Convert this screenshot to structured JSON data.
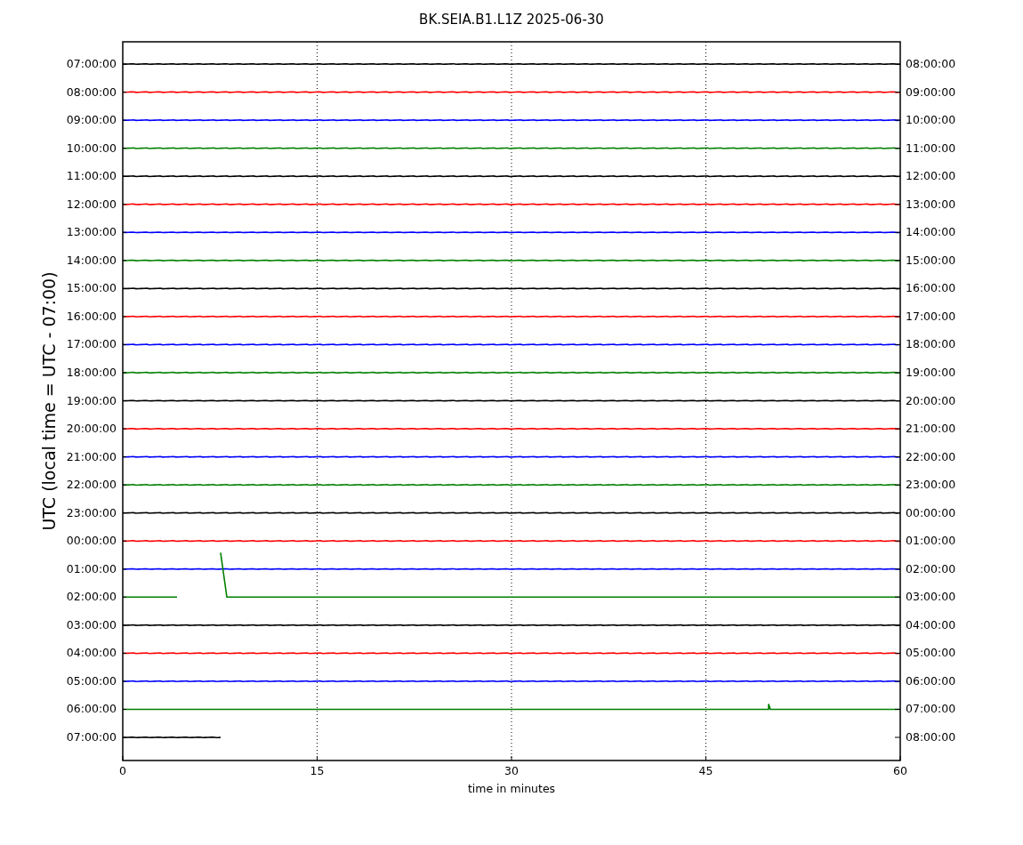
{
  "title": "BK.SEIA.B1.L1Z 2025-06-30",
  "ylabel": "UTC (local time = UTC - 07:00)",
  "xlabel": "time in minutes",
  "xticks": [
    "0",
    "15",
    "30",
    "45",
    "60"
  ],
  "rows": [
    {
      "left": "07:00:00",
      "right": "08:00:00",
      "color": "#000000"
    },
    {
      "left": "08:00:00",
      "right": "09:00:00",
      "color": "#ff0000"
    },
    {
      "left": "09:00:00",
      "right": "10:00:00",
      "color": "#0000ff"
    },
    {
      "left": "10:00:00",
      "right": "11:00:00",
      "color": "#008000"
    },
    {
      "left": "11:00:00",
      "right": "12:00:00",
      "color": "#000000"
    },
    {
      "left": "12:00:00",
      "right": "13:00:00",
      "color": "#ff0000"
    },
    {
      "left": "13:00:00",
      "right": "14:00:00",
      "color": "#0000ff"
    },
    {
      "left": "14:00:00",
      "right": "15:00:00",
      "color": "#008000"
    },
    {
      "left": "15:00:00",
      "right": "16:00:00",
      "color": "#000000"
    },
    {
      "left": "16:00:00",
      "right": "17:00:00",
      "color": "#ff0000"
    },
    {
      "left": "17:00:00",
      "right": "18:00:00",
      "color": "#0000ff"
    },
    {
      "left": "18:00:00",
      "right": "19:00:00",
      "color": "#008000"
    },
    {
      "left": "19:00:00",
      "right": "20:00:00",
      "color": "#000000"
    },
    {
      "left": "20:00:00",
      "right": "21:00:00",
      "color": "#ff0000"
    },
    {
      "left": "21:00:00",
      "right": "22:00:00",
      "color": "#0000ff"
    },
    {
      "left": "22:00:00",
      "right": "23:00:00",
      "color": "#008000"
    },
    {
      "left": "23:00:00",
      "right": "00:00:00",
      "color": "#000000"
    },
    {
      "left": "00:00:00",
      "right": "01:00:00",
      "color": "#ff0000"
    },
    {
      "left": "01:00:00",
      "right": "02:00:00",
      "color": "#0000ff"
    },
    {
      "left": "02:00:00",
      "right": "03:00:00",
      "color": "#008000"
    },
    {
      "left": "03:00:00",
      "right": "04:00:00",
      "color": "#000000"
    },
    {
      "left": "04:00:00",
      "right": "05:00:00",
      "color": "#ff0000"
    },
    {
      "left": "05:00:00",
      "right": "06:00:00",
      "color": "#0000ff"
    },
    {
      "left": "06:00:00",
      "right": "07:00:00",
      "color": "#008000"
    },
    {
      "left": "07:00:00",
      "right": "08:00:00",
      "color": "#000000"
    }
  ]
}
